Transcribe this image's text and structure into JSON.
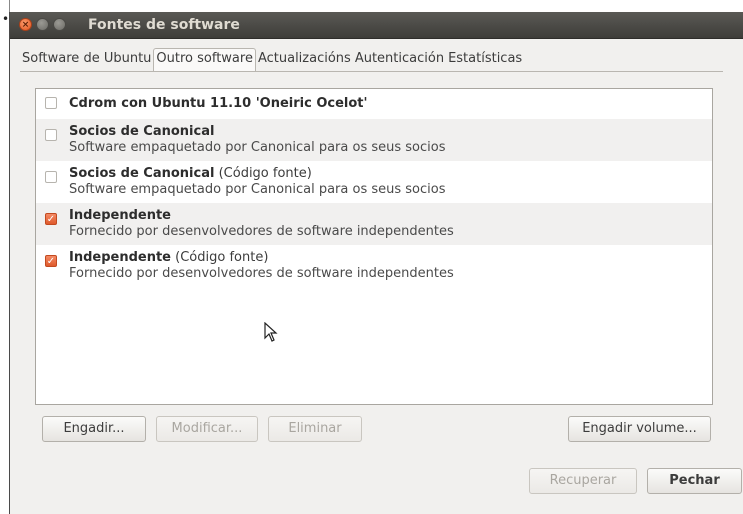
{
  "window": {
    "title": "Fontes de software"
  },
  "tabs": [
    {
      "label": "Software de Ubuntu",
      "active": false
    },
    {
      "label": "Outro software",
      "active": true
    },
    {
      "label": "Actualizacións",
      "active": false
    },
    {
      "label": "Autenticación",
      "active": false
    },
    {
      "label": "Estatísticas",
      "active": false
    }
  ],
  "sources": [
    {
      "name": "Cdrom con Ubuntu 11.10 'Oneiric Ocelot'",
      "suffix": "",
      "description": "",
      "checked": false
    },
    {
      "name": "Socios de Canonical",
      "suffix": "",
      "description": "Software empaquetado por Canonical para os seus socios",
      "checked": false
    },
    {
      "name": "Socios de Canonical",
      "suffix": " (Código fonte)",
      "description": "Software empaquetado por Canonical para os seus socios",
      "checked": false
    },
    {
      "name": "Independente",
      "suffix": "",
      "description": "Fornecido por desenvolvedores de software independentes",
      "checked": true
    },
    {
      "name": "Independente",
      "suffix": " (Código fonte)",
      "description": "Fornecido por desenvolvedores de software independentes",
      "checked": true
    }
  ],
  "buttons": {
    "add": "Engadir...",
    "modify": "Modificar...",
    "remove": "Eliminar",
    "add_volume": "Engadir volume...",
    "revert": "Recuperar",
    "close": "Pechar"
  },
  "colors": {
    "accent": "#df5a2c",
    "titlebar": "#3e3d39"
  }
}
